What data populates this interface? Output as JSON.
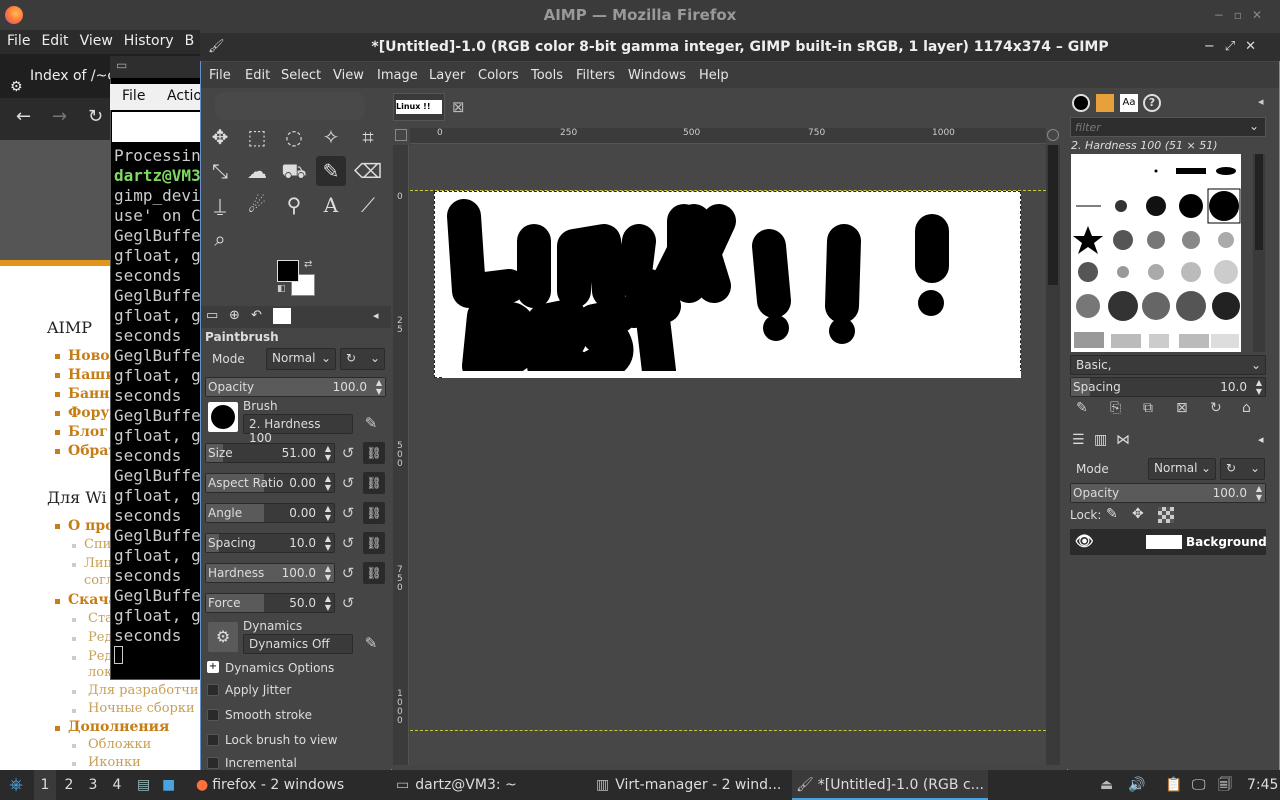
{
  "firefox": {
    "title": "AIMP — Mozilla Firefox",
    "menu": [
      "File",
      "Edit",
      "View",
      "History",
      "B"
    ],
    "tab_title": "Index of /~c",
    "page": {
      "heading1": "AIMP",
      "links1": [
        "Ново",
        "Наши",
        "Банне",
        "Форум",
        "Блог",
        "Обрат"
      ],
      "heading2": "Для Wi",
      "section_link": "О про",
      "sub_links": [
        "Спи",
        "Лиц",
        "согл"
      ],
      "download_link": "Скача",
      "download_sub": [
        "Ста",
        "Ред",
        "Ред",
        "лок",
        "Для разработчи",
        "Ночные сборки"
      ],
      "addons": "Дополнения",
      "addons_sub": [
        "Обложки",
        "Иконки"
      ]
    }
  },
  "terminal": {
    "menu": [
      "File",
      "Actio"
    ],
    "lines": [
      {
        "text": "Processin",
        "green": false
      },
      {
        "text": "dartz@VM3",
        "green": true
      },
      {
        "text": "gimp_devi",
        "green": false
      },
      {
        "text": "use' on C",
        "green": false
      },
      {
        "text": "GeglBuffe",
        "green": false
      },
      {
        "text": "gfloat, g",
        "green": false
      },
      {
        "text": "seconds",
        "green": false
      },
      {
        "text": "GeglBuffe",
        "green": false
      },
      {
        "text": "gfloat, g",
        "green": false
      },
      {
        "text": "seconds",
        "green": false
      },
      {
        "text": "GeglBuffe",
        "green": false
      },
      {
        "text": "gfloat, g",
        "green": false
      },
      {
        "text": "seconds",
        "green": false
      },
      {
        "text": "GeglBuffe",
        "green": false
      },
      {
        "text": "gfloat, g",
        "green": false
      },
      {
        "text": "seconds",
        "green": false
      },
      {
        "text": "GeglBuffe",
        "green": false
      },
      {
        "text": "gfloat, g",
        "green": false
      },
      {
        "text": "seconds",
        "green": false
      },
      {
        "text": "GeglBuffe",
        "green": false
      },
      {
        "text": "gfloat, g",
        "green": false
      },
      {
        "text": "seconds",
        "green": false
      },
      {
        "text": "GeglBuffe",
        "green": false
      },
      {
        "text": "gfloat, g",
        "green": false
      },
      {
        "text": "seconds",
        "green": false
      }
    ]
  },
  "gimp": {
    "title": "*[Untitled]-1.0 (RGB color 8-bit gamma integer, GIMP built-in sRGB, 1 layer) 1174x374 – GIMP",
    "menu": [
      "File",
      "Edit",
      "Select",
      "View",
      "Image",
      "Layer",
      "Colors",
      "Tools",
      "Filters",
      "Windows",
      "Help"
    ],
    "tool_options": {
      "title": "Paintbrush",
      "mode_label": "Mode",
      "mode_value": "Normal",
      "opacity_label": "Opacity",
      "opacity_value": "100.0",
      "brush_label": "Brush",
      "brush_value": "2. Hardness 100",
      "size_label": "Size",
      "size_value": "51.00",
      "aspect_label": "Aspect Ratio",
      "aspect_value": "0.00",
      "angle_label": "Angle",
      "angle_value": "0.00",
      "spacing_label": "Spacing",
      "spacing_value": "10.0",
      "hardness_label": "Hardness",
      "hardness_value": "100.0",
      "force_label": "Force",
      "force_value": "50.0",
      "dynamics_label": "Dynamics",
      "dynamics_value": "Dynamics Off",
      "dynamics_options": "Dynamics Options",
      "apply_jitter": "Apply Jitter",
      "smooth_stroke": "Smooth stroke",
      "lock_brush": "Lock brush to view",
      "incremental": "Incremental"
    },
    "ruler_marks": [
      "250",
      "500",
      "750",
      "1000"
    ],
    "ruler_zero": "0",
    "vruler_marks": [
      {
        "chars": [
          "0"
        ]
      },
      {
        "chars": [
          "2",
          "5"
        ]
      },
      {
        "chars": [
          "5",
          "0",
          "0"
        ]
      },
      {
        "chars": [
          "7",
          "5",
          "0"
        ]
      },
      {
        "chars": [
          "1",
          "0",
          "0",
          "0"
        ]
      }
    ],
    "brushes": {
      "filter_placeholder": "filter",
      "selected": "2. Hardness 100 (51 × 51)",
      "preset": "Basic,",
      "spacing_label": "Spacing",
      "spacing_value": "10.0"
    },
    "layers": {
      "mode_label": "Mode",
      "mode_value": "Normal",
      "opacity_label": "Opacity",
      "opacity_value": "100.0",
      "lock_label": "Lock:",
      "layer_name": "Background"
    }
  },
  "taskbar": {
    "workspaces": [
      "1",
      "2",
      "3",
      "4"
    ],
    "items": [
      {
        "label": "firefox - 2 windows"
      },
      {
        "label": "dartz@VM3: ~"
      },
      {
        "label": "Virt-manager - 2 wind..."
      },
      {
        "label": "*[Untitled]-1.0 (RGB c..."
      }
    ],
    "clock": "7:45"
  }
}
